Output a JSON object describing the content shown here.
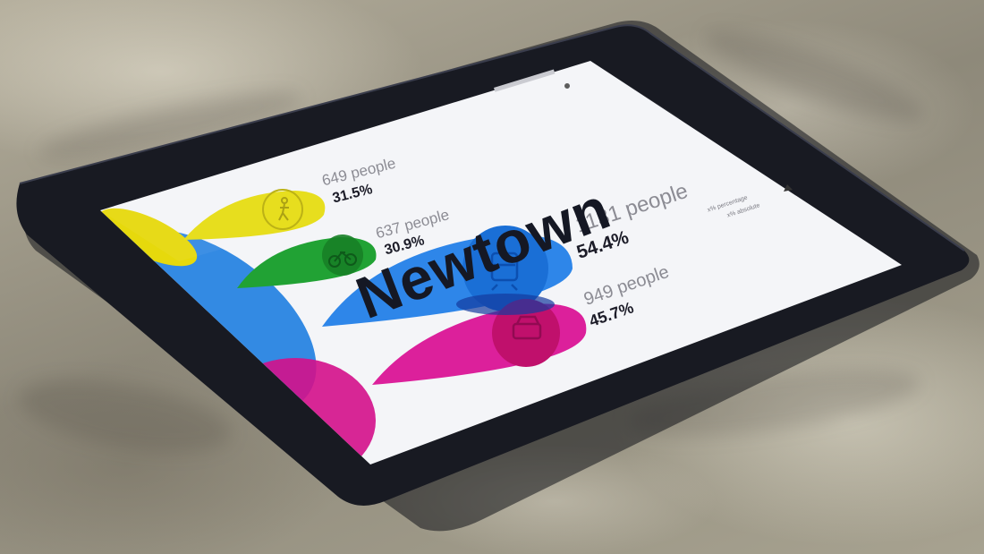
{
  "scene": {
    "description_tag": "",
    "colors": {
      "walking": "#e6d90c",
      "cycling": "#1c9a2c",
      "train": "#1e6fd8",
      "car": "#d4108a",
      "device_frame": "#16181f"
    }
  },
  "screen": {
    "title": "Newtown",
    "status_text": "",
    "legend": {
      "line1": "x% percentage",
      "line2": "x% absolute"
    },
    "modes": [
      {
        "icon": "walking-person-icon",
        "people": "649 people",
        "percent": "31.5%"
      },
      {
        "icon": "bicycle-icon",
        "people": "637 people",
        "percent": "30.9%"
      },
      {
        "icon": "train-icon",
        "people": "1131 people",
        "percent": "54.4%"
      },
      {
        "icon": "car-icon",
        "people": "949 people",
        "percent": "45.7%"
      }
    ]
  }
}
